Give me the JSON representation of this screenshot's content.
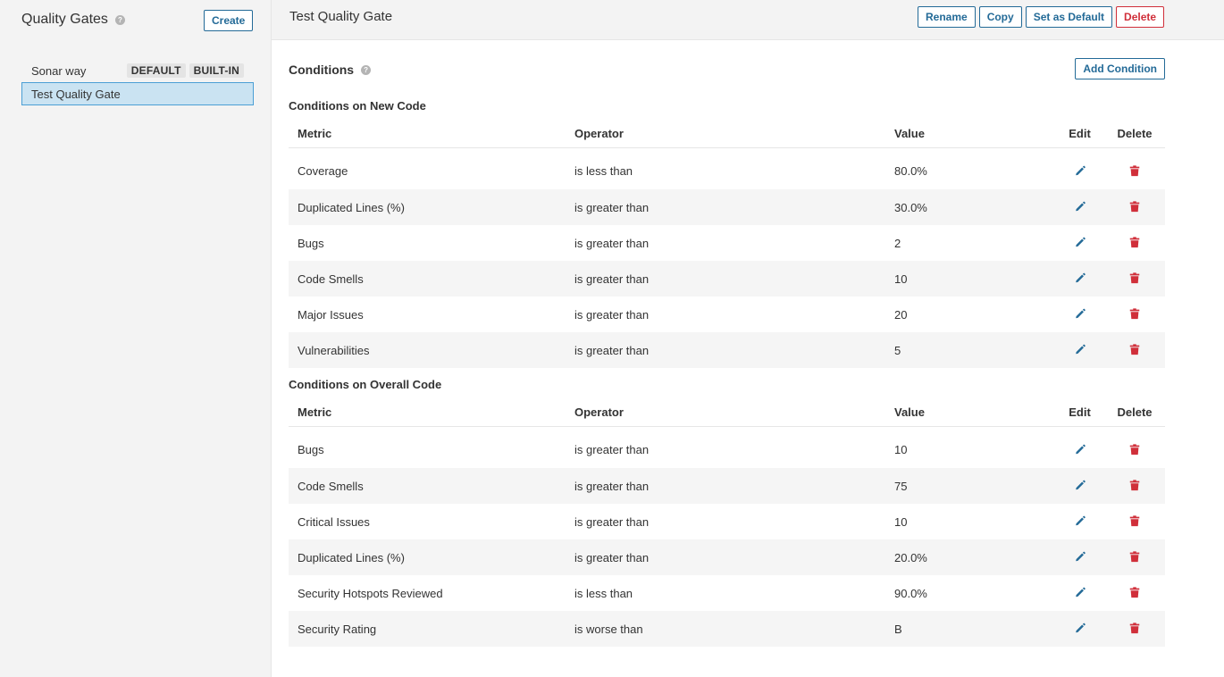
{
  "sidebar": {
    "title": "Quality Gates",
    "create_label": "Create",
    "gates": [
      {
        "name": "Sonar way",
        "badges": [
          "DEFAULT",
          "BUILT-IN"
        ]
      },
      {
        "name": "Test Quality Gate",
        "badges": []
      }
    ]
  },
  "header": {
    "title": "Test Quality Gate",
    "rename_label": "Rename",
    "copy_label": "Copy",
    "default_label": "Set as Default",
    "delete_label": "Delete"
  },
  "conditions": {
    "title": "Conditions",
    "add_label": "Add Condition",
    "columns": {
      "metric": "Metric",
      "operator": "Operator",
      "value": "Value",
      "edit": "Edit",
      "delete": "Delete"
    },
    "new_code": {
      "title": "Conditions on New Code",
      "rows": [
        {
          "metric": "Coverage",
          "operator": "is less than",
          "value": "80.0%"
        },
        {
          "metric": "Duplicated Lines (%)",
          "operator": "is greater than",
          "value": "30.0%"
        },
        {
          "metric": "Bugs",
          "operator": "is greater than",
          "value": "2"
        },
        {
          "metric": "Code Smells",
          "operator": "is greater than",
          "value": "10"
        },
        {
          "metric": "Major Issues",
          "operator": "is greater than",
          "value": "20"
        },
        {
          "metric": "Vulnerabilities",
          "operator": "is greater than",
          "value": "5"
        }
      ]
    },
    "overall_code": {
      "title": "Conditions on Overall Code",
      "rows": [
        {
          "metric": "Bugs",
          "operator": "is greater than",
          "value": "10"
        },
        {
          "metric": "Code Smells",
          "operator": "is greater than",
          "value": "75"
        },
        {
          "metric": "Critical Issues",
          "operator": "is greater than",
          "value": "10"
        },
        {
          "metric": "Duplicated Lines (%)",
          "operator": "is greater than",
          "value": "20.0%"
        },
        {
          "metric": "Security Hotspots Reviewed",
          "operator": "is less than",
          "value": "90.0%"
        },
        {
          "metric": "Security Rating",
          "operator": "is worse than",
          "value": "B"
        }
      ]
    }
  },
  "colors": {
    "accent": "#236a97",
    "danger": "#d02f3a",
    "selected_bg": "#cae3f2",
    "edit_icon": "#236a97",
    "delete_icon": "#d02f3a"
  },
  "icons": {
    "help": "help-icon",
    "edit": "pencil-icon",
    "delete": "trash-icon"
  }
}
